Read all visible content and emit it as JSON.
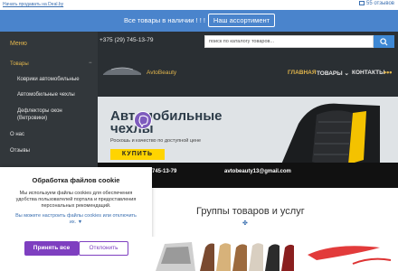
{
  "topbar": {
    "sell_link": "Начать продавать на Deal.by",
    "cart": "55 отзывов"
  },
  "banner": {
    "text": "Все товары в наличии ! ! !",
    "button": "Наш ассортимент"
  },
  "header": {
    "phone": "+375 (29) 745-13-79",
    "search_placeholder": "поиск по каталогу товаров...",
    "brand": "AvtoBeauty",
    "nav": [
      "ГЛАВНАЯ",
      "ТОВАРЫ",
      "КОНТАКТЫ"
    ]
  },
  "side": {
    "title": "Меню",
    "items": [
      "Товары",
      "Коврики автомобильные",
      "Автомобильные чехлы",
      "Дефлекторы окон (Ветровики)",
      "О нас",
      "Отзывы"
    ]
  },
  "hero": {
    "title_line1": "Автомобильные",
    "title_line2": "чехлы",
    "subtitle": "Роскошь и качество по доступной цене",
    "buy": "КУПИТЬ",
    "phone": "745-13-79",
    "email": "avtobeauty13@gmail.com"
  },
  "cookie": {
    "title": "Обработка файлов cookie",
    "body": "Мы используем файлы cookies для обеспечения удобства пользователей портала и предоставления персональных рекомендаций.",
    "link": "Вы можете настроить файлы cookies или отключить их. ▼",
    "accept": "Принять все",
    "decline": "Отклонить"
  },
  "groups": {
    "title": "Группы товаров и услуг"
  },
  "colors": {
    "accent": "#e1b54c",
    "banner": "#4a84cc",
    "purple": "#7e3fc0"
  }
}
